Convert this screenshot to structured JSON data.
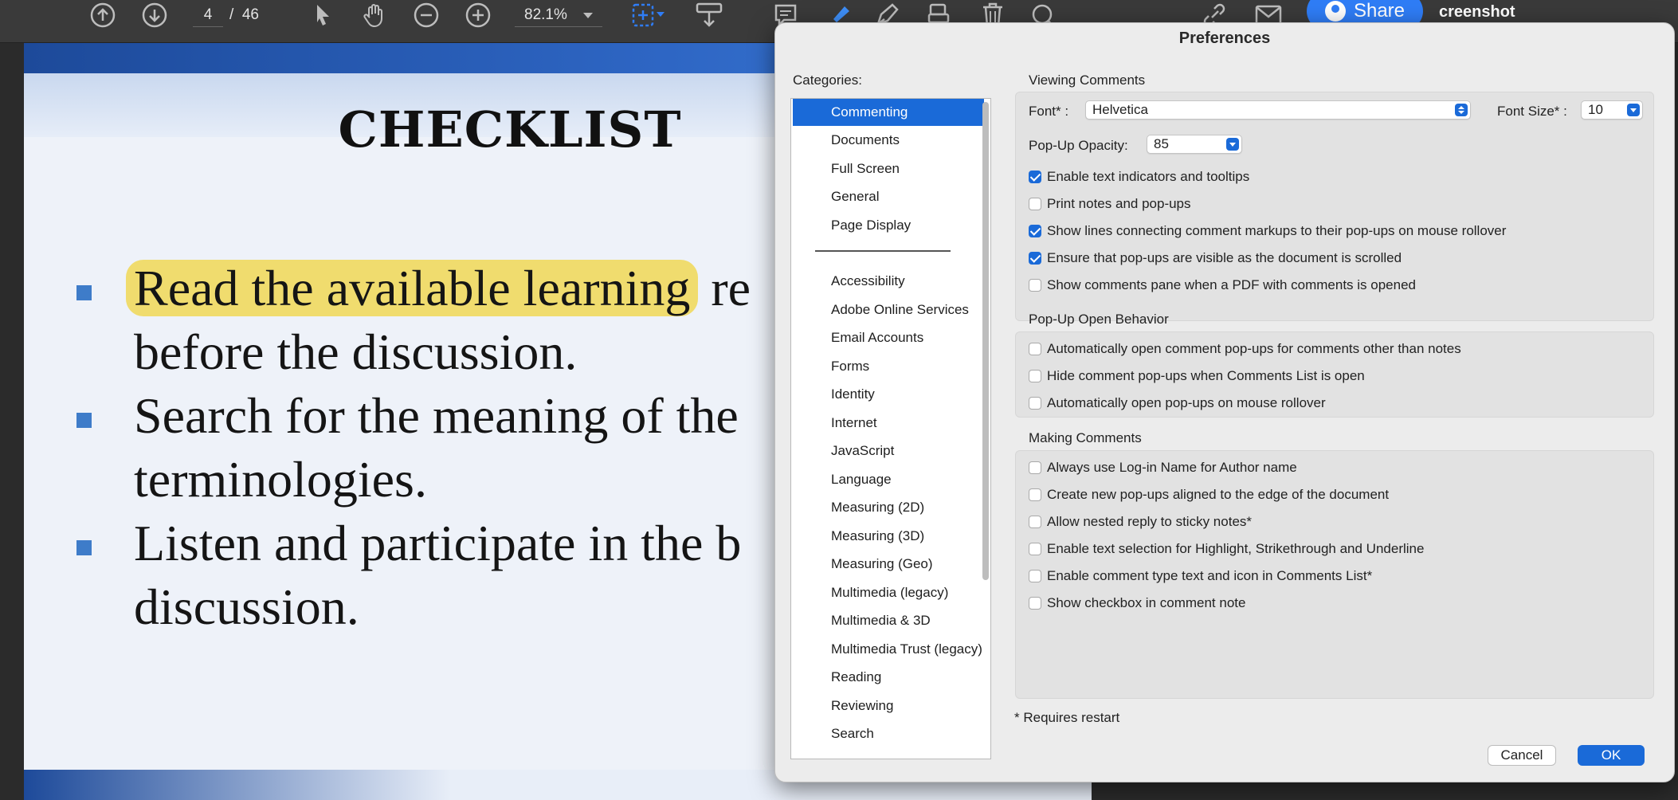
{
  "toolbar": {
    "page_current": "4",
    "page_separator": "/",
    "page_total": "46",
    "zoom": "82.1%",
    "share_label": "Share",
    "window_title_fragment": "creenshot"
  },
  "document": {
    "title": "CHECKLIST",
    "bullets": [
      {
        "highlighted": "Read the available learning",
        "rest": " re",
        "line2": "before the discussion."
      },
      {
        "line1": "Search for the meaning of  the",
        "line2": "terminologies."
      },
      {
        "line1": "Listen and participate in the b",
        "line2": "discussion."
      }
    ]
  },
  "dialog": {
    "title": "Preferences",
    "categories_label": "Categories:",
    "categories_top": [
      "Commenting",
      "Documents",
      "Full Screen",
      "General",
      "Page Display"
    ],
    "categories_bottom": [
      "Accessibility",
      "Adobe Online Services",
      "Email Accounts",
      "Forms",
      "Identity",
      "Internet",
      "JavaScript",
      "Language",
      "Measuring (2D)",
      "Measuring (3D)",
      "Measuring (Geo)",
      "Multimedia (legacy)",
      "Multimedia & 3D",
      "Multimedia Trust (legacy)",
      "Reading",
      "Reviewing",
      "Search"
    ],
    "selected_category": "Commenting",
    "viewing": {
      "title": "Viewing Comments",
      "font_label": "Font* :",
      "font_value": "Helvetica",
      "font_size_label": "Font Size* :",
      "font_size_value": "10",
      "opacity_label": "Pop-Up Opacity:",
      "opacity_value": "85",
      "options": [
        {
          "label": "Enable text indicators and tooltips",
          "checked": true
        },
        {
          "label": "Print notes and pop-ups",
          "checked": false
        },
        {
          "label": "Show lines connecting comment markups to their pop-ups on mouse rollover",
          "checked": true
        },
        {
          "label": "Ensure that pop-ups are visible as the document is scrolled",
          "checked": true
        },
        {
          "label": "Show comments pane when a PDF with comments is opened",
          "checked": false
        }
      ]
    },
    "popup": {
      "title": "Pop-Up Open Behavior",
      "options": [
        {
          "label": "Automatically open comment pop-ups for comments other than notes",
          "checked": false
        },
        {
          "label": "Hide comment pop-ups when Comments List is open",
          "checked": false
        },
        {
          "label": "Automatically open pop-ups on mouse rollover",
          "checked": false
        }
      ]
    },
    "making": {
      "title": "Making Comments",
      "options": [
        {
          "label": "Always use Log-in Name for Author name",
          "checked": false
        },
        {
          "label": "Create new pop-ups aligned to the edge of the document",
          "checked": false
        },
        {
          "label": "Allow nested reply to sticky notes*",
          "checked": false
        },
        {
          "label": "Enable text selection for Highlight, Strikethrough and Underline",
          "checked": false
        },
        {
          "label": "Enable comment type text and icon in Comments List*",
          "checked": false
        },
        {
          "label": "Show checkbox in comment note",
          "checked": false
        }
      ]
    },
    "restart_note": "* Requires restart",
    "cancel_label": "Cancel",
    "ok_label": "OK"
  }
}
